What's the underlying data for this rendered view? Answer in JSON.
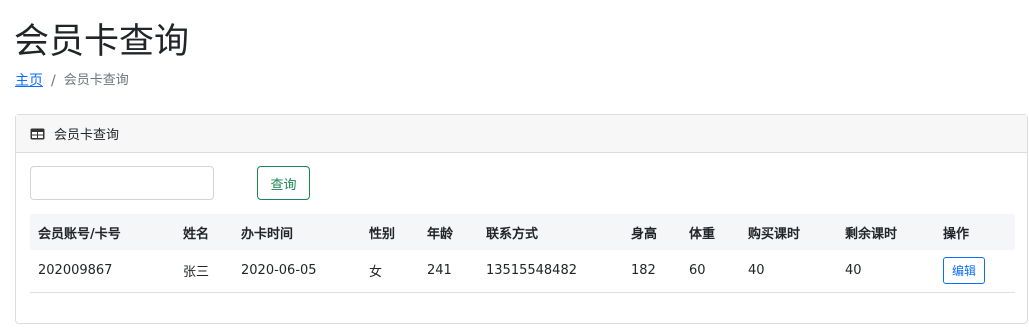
{
  "page": {
    "title": "会员卡查询"
  },
  "breadcrumb": {
    "home": "主页",
    "separator": "/",
    "current": "会员卡查询"
  },
  "card": {
    "header": "会员卡查询",
    "header_icon": "table-icon"
  },
  "search": {
    "value": "",
    "placeholder": "",
    "button_label": "查询"
  },
  "table": {
    "headers": [
      "会员账号/卡号",
      "姓名",
      "办卡时间",
      "性别",
      "年龄",
      "联系方式",
      "身高",
      "体重",
      "购买课时",
      "剩余课时",
      "操作"
    ],
    "rows": [
      {
        "account": "202009867",
        "name": "张三",
        "date": "2020-06-05",
        "gender": "女",
        "age": "241",
        "phone": "13515548482",
        "height": "182",
        "weight": "60",
        "purchased_hours": "40",
        "remaining_hours": "40",
        "action_label": "编辑"
      }
    ]
  },
  "colors": {
    "link": "#0d6efd",
    "success": "#198754",
    "border": "#dcdcdc"
  }
}
